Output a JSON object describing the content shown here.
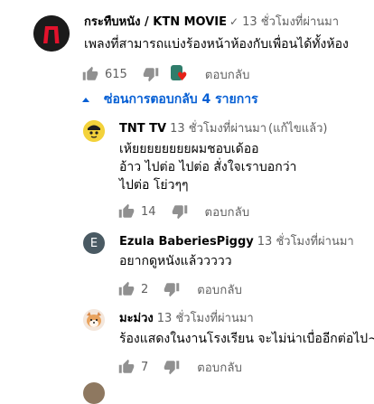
{
  "main_comment": {
    "author": "กระทืบหนัง / KTN MOVIE",
    "verified_symbol": "✓",
    "timestamp": "13 ชั่วโมงที่ผ่านมา",
    "text": "เพลงที่สามารถแบ่งร้องหน้าห้องกับเพื่อนได้ทั้งห้อง",
    "like_count": "615",
    "reply_label": "ตอบกลับ",
    "hearted": true
  },
  "hide_replies_label": "ซ่อนการตอบกลับ 4 รายการ",
  "replies": [
    {
      "author": "TNT TV",
      "timestamp": "13 ชั่วโมงที่ผ่านมา",
      "edited": "(แก้ไขแล้ว)",
      "lines": [
        "เห้ยยยยยยยยผมชอบเด้ออ",
        "อ้าว ไปต่อ ไปต่อ สั่งใจเราบอกว่า",
        "ไปต่อ โย่วๆๆ"
      ],
      "like_count": "14",
      "reply_label": "ตอบกลับ"
    },
    {
      "author": "Ezula BaberiesPiggy",
      "avatar_letter": "E",
      "timestamp": "13 ชั่วโมงที่ผ่านมา",
      "lines": [
        "อยากดูหนังแล้ววววว"
      ],
      "like_count": "2",
      "reply_label": "ตอบกลับ"
    },
    {
      "author": "มะม่วง",
      "timestamp": "13 ชั่วโมงที่ผ่านมา",
      "lines": [
        "ร้องแสดงในงานโรงเรียน จะไม่น่าเบื่ออีกต่อไป~"
      ],
      "like_count": "7",
      "reply_label": "ตอบกลับ"
    }
  ],
  "icons": {
    "like": "thumb-up-icon",
    "dislike": "thumb-down-icon",
    "heart": "heart-icon",
    "collapse": "caret-up-icon"
  },
  "colors": {
    "link_blue": "#065fd4",
    "secondary_text": "#606060",
    "primary_text": "#030303",
    "heart_red": "#e62117",
    "icon_gray": "#909090"
  }
}
